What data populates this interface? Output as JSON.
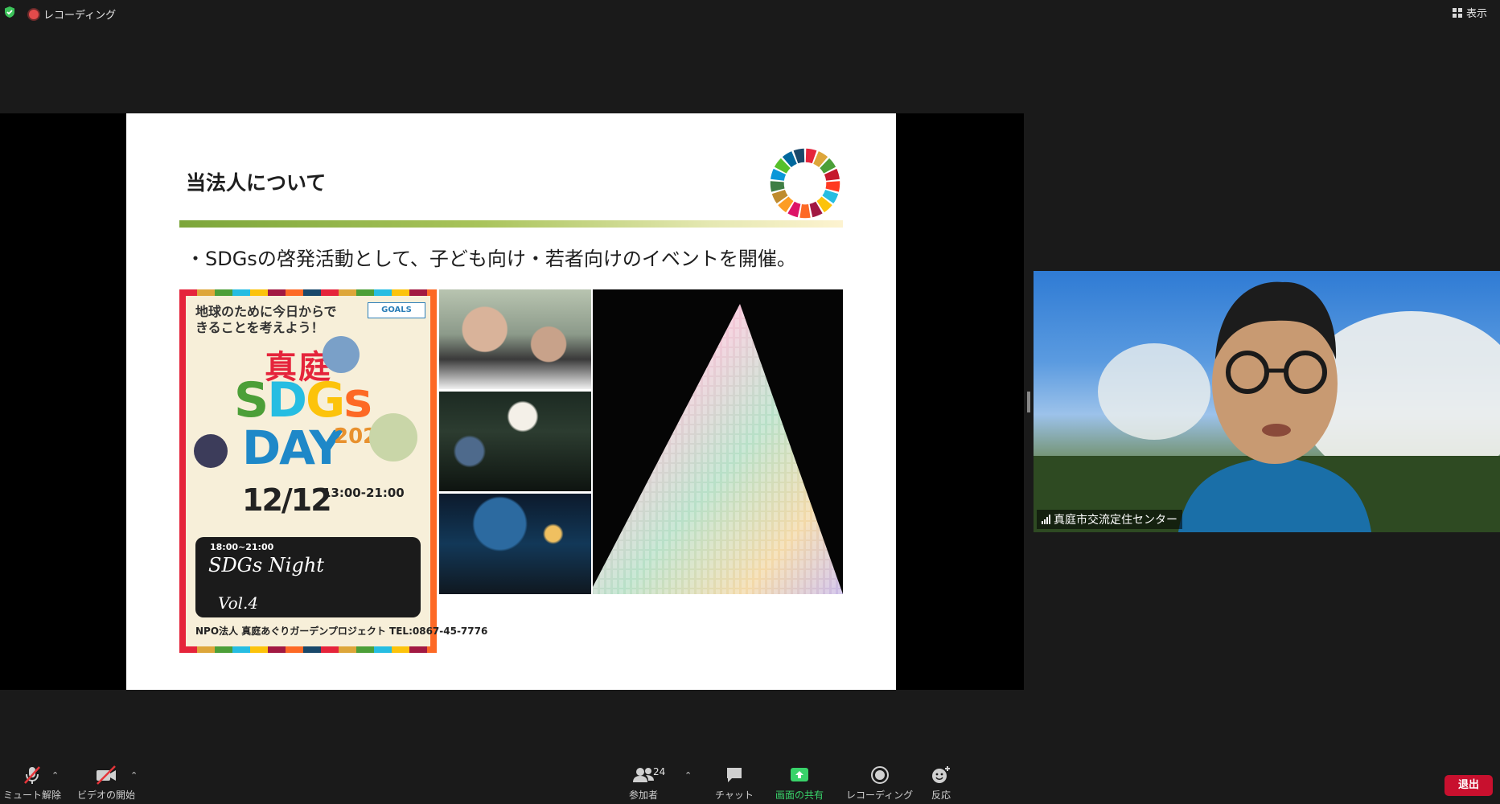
{
  "top_bar": {
    "recording_label": "レコーディング",
    "view_label": "表示"
  },
  "slide": {
    "title": "当法人について",
    "bullet": "・SDGsの啓発活動として、子ども向け・若者向けのイベントを開催。",
    "poster": {
      "headline": "地球のために今日からできることを考えよう！",
      "goals_badge": "GOALS",
      "city": "真庭",
      "sdgs": "SDGs",
      "day": "DAY",
      "year": "2020",
      "date": "12/12",
      "time": "13:00-21:00",
      "night_time": "18:00~21:00",
      "night_title": "SDGs Night",
      "night_vol": "Vol.4",
      "contact": "NPO法人 真庭あぐりガーデンプロジェクト TEL:0867-45-7776"
    }
  },
  "video": {
    "participant_name": "真庭市交流定住センター"
  },
  "toolbar": {
    "mute_label": "ミュート解除",
    "video_label": "ビデオの開始",
    "participants_label": "参加者",
    "participants_count": "24",
    "chat_label": "チャット",
    "share_label": "画面の共有",
    "record_label": "レコーディング",
    "reactions_label": "反応",
    "leave_label": "退出"
  },
  "colors": {
    "share_green": "#39d36a",
    "leave_red": "#c8102e",
    "recording_red": "#e34b4b"
  }
}
